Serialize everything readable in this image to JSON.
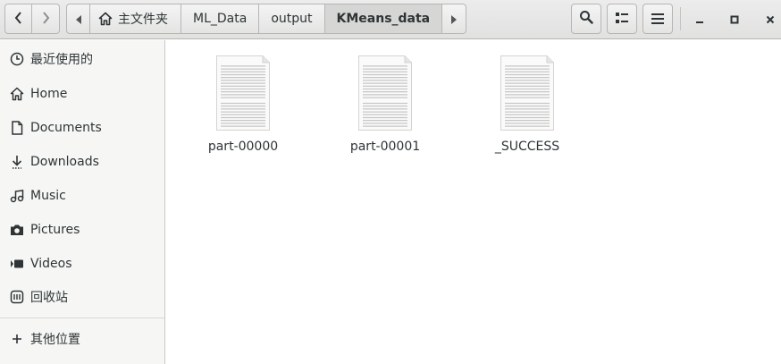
{
  "toolbar": {
    "back_icon": "chevron-left-icon",
    "forward_icon": "chevron-right-icon",
    "search_icon": "search-icon",
    "view_icon": "list-view-icon",
    "menu_icon": "hamburger-menu-icon"
  },
  "path_bar": {
    "crumbs": [
      {
        "label": "主文件夹",
        "icon": "home-icon"
      },
      {
        "label": "ML_Data"
      },
      {
        "label": "output"
      },
      {
        "label": "KMeans_data",
        "active": true
      }
    ]
  },
  "window_controls": {
    "minimize_icon": "minimize-icon",
    "maximize_icon": "maximize-icon",
    "close_icon": "close-icon"
  },
  "sidebar": {
    "items": [
      {
        "label": "最近使用的",
        "icon": "recent-clock-icon"
      },
      {
        "label": "Home",
        "icon": "home-icon"
      },
      {
        "label": "Documents",
        "icon": "document-icon"
      },
      {
        "label": "Downloads",
        "icon": "download-icon"
      },
      {
        "label": "Music",
        "icon": "music-icon"
      },
      {
        "label": "Pictures",
        "icon": "camera-icon"
      },
      {
        "label": "Videos",
        "icon": "video-icon"
      },
      {
        "label": "回收站",
        "icon": "trash-icon"
      },
      {
        "label": "其他位置",
        "icon": "plus-icon"
      }
    ]
  },
  "files": [
    {
      "name": "part-00000",
      "icon": "text-file-icon"
    },
    {
      "name": "part-00001",
      "icon": "text-file-icon"
    },
    {
      "name": "_SUCCESS",
      "icon": "text-file-icon"
    }
  ],
  "colors": {
    "header_bg": "#e1e1e0",
    "sidebar_bg": "#f6f6f5",
    "active_crumb_bg": "#d6d6d4",
    "text": "#2e3436"
  }
}
